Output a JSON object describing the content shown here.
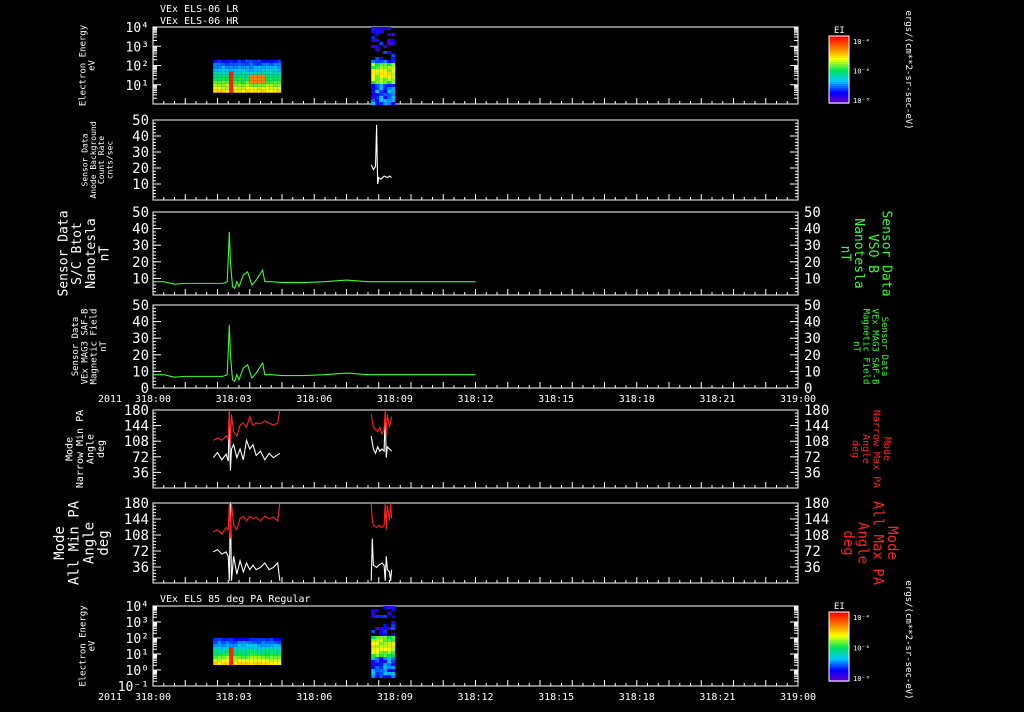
{
  "header": {
    "line1": "VEx ELS-06 LR",
    "line2": "VEx ELS-06 HR"
  },
  "panel7_title": "VEx ELS 85 deg PA Regular",
  "colorbar": {
    "label": "EI",
    "ticks": [
      "10⁻⁴",
      "10⁻⁶",
      "10⁻⁸"
    ],
    "side_label": "ergs/(cm**2-sr-sec-eV)"
  },
  "x_axis": {
    "year": "2011",
    "ticks": [
      "318:00",
      "318:03",
      "318:06",
      "318:09",
      "318:12",
      "318:15",
      "318:18",
      "318:21",
      "319:00"
    ]
  },
  "chart_data": [
    {
      "type": "heatmap",
      "id": "p1",
      "ylabel": [
        "Electron Energy",
        "eV"
      ],
      "ylim_exp": [
        0,
        4
      ],
      "yticks": [
        "10⁴",
        "10³",
        "10²",
        "10¹"
      ],
      "xlim_min": [
        0,
        60
      ],
      "segments": [
        {
          "x_range": [
            5.6,
            11.8
          ],
          "E_range_exp": [
            0.6,
            2.3
          ],
          "features": "red peak at 318:07 near 20 eV, red-orange streak 318:09-318:10"
        },
        {
          "x_range": [
            20.3,
            22.3
          ],
          "E_range_exp": [
            0.1,
            4.0
          ],
          "features": "green/yellow band 10-100 eV, purple noise above"
        }
      ]
    },
    {
      "type": "line",
      "id": "p2",
      "ylabel": [
        "Sensor Data",
        "Anode Background",
        "Count Rate",
        "cnts/sec"
      ],
      "ylim": [
        0,
        50
      ],
      "yticks": [
        10,
        20,
        30,
        40,
        50
      ],
      "series": [
        {
          "color": "#ffffff",
          "x_min": [
            20.3,
            20.5,
            20.7,
            20.8,
            20.85,
            20.9,
            21.0,
            21.2,
            21.5,
            21.8,
            22.0,
            22.2
          ],
          "y": [
            22,
            19,
            21,
            47,
            28,
            10,
            14,
            13,
            15,
            14,
            15,
            14
          ]
        }
      ]
    },
    {
      "type": "line",
      "id": "p3",
      "ylabel": [
        "Sensor Data",
        "S/C Btot",
        "Nanotesla",
        "nT"
      ],
      "right_label": [
        "Sensor Data",
        "VSO B",
        "Nanotesla",
        "nT"
      ],
      "ylim": [
        0,
        50
      ],
      "yticks": [
        10,
        20,
        30,
        40,
        50
      ],
      "series": [
        {
          "color": "#33ff33",
          "x_min": [
            0,
            1,
            2,
            3,
            4,
            5,
            6,
            6.5,
            6.9,
            7.0,
            7.1,
            7.2,
            7.4,
            7.6,
            7.8,
            8.0,
            8.4,
            8.8,
            9.0,
            9.2,
            9.6,
            10.0,
            10.2,
            10.4,
            11,
            12,
            14,
            16,
            18,
            20,
            22,
            24,
            26,
            28,
            30
          ],
          "y": [
            8,
            8,
            6.5,
            7,
            7,
            7,
            7,
            7,
            8,
            22,
            38,
            20,
            5,
            4,
            8,
            5,
            12,
            14,
            10,
            6,
            9,
            13,
            15,
            8,
            8,
            7.5,
            7.5,
            8,
            9,
            8,
            8,
            8,
            8,
            8,
            8
          ]
        }
      ]
    },
    {
      "type": "line",
      "id": "p4",
      "ylabel": [
        "Sensor Data",
        "VEx MAG3 SAF-B",
        "Magnetic Field",
        "nT"
      ],
      "right_label": [
        "Sensor Data",
        "VEx MAG3 SAF-B",
        "Magnetic Field",
        "nT"
      ],
      "ylim": [
        0,
        50
      ],
      "yticks": [
        0,
        10,
        20,
        30,
        40,
        50
      ],
      "series": [
        {
          "color": "#33ff33",
          "x_min": [
            0,
            1,
            2,
            3,
            4,
            5,
            6,
            6.5,
            6.9,
            7.0,
            7.1,
            7.2,
            7.4,
            7.6,
            7.8,
            8.0,
            8.4,
            8.8,
            9.0,
            9.2,
            9.6,
            10.0,
            10.2,
            10.4,
            11,
            12,
            14,
            16,
            18,
            20,
            22,
            24,
            26,
            28,
            30
          ],
          "y": [
            8,
            8,
            6.5,
            7,
            7,
            7,
            7,
            7,
            8,
            22,
            38,
            20,
            5,
            4,
            8,
            5,
            12,
            14,
            10,
            6,
            9,
            13,
            15,
            8,
            8,
            7.5,
            7.5,
            8,
            9,
            8,
            8,
            8,
            8,
            8,
            8
          ]
        }
      ]
    },
    {
      "type": "line",
      "id": "p5",
      "ylabel": [
        "Mode",
        "Narrow Min PA",
        "Angle",
        "deg"
      ],
      "right_label": [
        "Mode",
        "Narrow Max PA",
        "Angle",
        "deg"
      ],
      "ylim": [
        0,
        180
      ],
      "yticks": [
        36,
        72,
        108,
        144,
        180
      ],
      "series": [
        {
          "color": "#ffffff",
          "x_min": [
            5.6,
            6.0,
            6.4,
            6.8,
            7.0,
            7.1,
            7.2,
            7.3,
            7.5,
            7.8,
            8.1,
            8.4,
            8.7,
            9.0,
            9.3,
            9.6,
            10.0,
            10.4,
            10.8,
            11.2,
            11.8
          ],
          "y": [
            70,
            82,
            65,
            78,
            62,
            175,
            40,
            90,
            100,
            70,
            90,
            65,
            110,
            90,
            100,
            75,
            85,
            65,
            80,
            70,
            80
          ]
        },
        {
          "color": "#ff2222",
          "x_min": [
            5.6,
            6.0,
            6.4,
            6.8,
            7.0,
            7.1,
            7.2,
            7.3,
            7.5,
            7.8,
            8.1,
            8.4,
            8.7,
            9.0,
            9.3,
            9.6,
            10.0,
            10.4,
            10.8,
            11.2,
            11.6,
            11.8
          ],
          "y": [
            110,
            115,
            110,
            120,
            115,
            180,
            100,
            170,
            130,
            120,
            145,
            150,
            140,
            165,
            145,
            150,
            148,
            155,
            150,
            145,
            150,
            180
          ]
        },
        {
          "color": "#ffffff",
          "x_min": [
            20.3,
            20.5,
            20.7,
            20.9,
            21.1,
            21.3,
            21.5,
            21.6,
            21.7,
            21.8,
            22.0,
            22.2
          ],
          "y": [
            120,
            90,
            80,
            95,
            85,
            90,
            85,
            170,
            70,
            95,
            90,
            85
          ]
        },
        {
          "color": "#ff2222",
          "x_min": [
            20.3,
            20.5,
            20.7,
            20.9,
            21.1,
            21.3,
            21.5,
            21.6,
            21.7,
            21.8,
            22.0,
            22.2
          ],
          "y": [
            170,
            140,
            135,
            130,
            140,
            125,
            135,
            180,
            120,
            170,
            140,
            165
          ]
        }
      ]
    },
    {
      "type": "line",
      "id": "p6",
      "ylabel": [
        "Mode",
        "All Min PA",
        "Angle",
        "deg"
      ],
      "right_label": [
        "Mode",
        "All Max PA",
        "Angle",
        "deg"
      ],
      "ylim": [
        0,
        180
      ],
      "yticks": [
        36,
        72,
        108,
        144,
        180
      ],
      "series": [
        {
          "color": "#ffffff",
          "x_min": [
            5.6,
            6.0,
            6.4,
            6.8,
            7.0,
            7.1,
            7.2,
            7.3,
            7.5,
            7.8,
            8.1,
            8.4,
            8.7,
            9.0,
            9.3,
            9.6,
            10.0,
            10.4,
            10.8,
            11.2,
            11.6,
            11.8
          ],
          "y": [
            70,
            75,
            65,
            70,
            60,
            5,
            180,
            5,
            60,
            20,
            50,
            25,
            45,
            30,
            40,
            30,
            35,
            45,
            30,
            35,
            45,
            5
          ]
        },
        {
          "color": "#ff2222",
          "x_min": [
            5.6,
            6.0,
            6.4,
            6.8,
            7.0,
            7.1,
            7.2,
            7.3,
            7.5,
            7.8,
            8.1,
            8.4,
            8.7,
            9.0,
            9.3,
            9.6,
            10.0,
            10.4,
            10.8,
            11.2,
            11.6,
            11.8
          ],
          "y": [
            115,
            120,
            110,
            125,
            120,
            180,
            100,
            180,
            130,
            120,
            145,
            150,
            140,
            150,
            145,
            148,
            140,
            150,
            145,
            148,
            140,
            180
          ]
        },
        {
          "color": "#ffffff",
          "x_min": [
            20.3,
            20.4,
            20.5,
            20.8,
            21.0,
            21.3,
            21.5,
            21.6,
            21.7,
            21.8,
            22.0,
            22.1,
            22.2
          ],
          "y": [
            5,
            100,
            40,
            35,
            40,
            45,
            40,
            5,
            60,
            30,
            25,
            5,
            30
          ]
        },
        {
          "color": "#ff2222",
          "x_min": [
            20.3,
            20.4,
            20.5,
            20.8,
            21.0,
            21.3,
            21.5,
            21.6,
            21.7,
            21.8,
            22.0,
            22.1,
            22.2
          ],
          "y": [
            180,
            140,
            130,
            125,
            130,
            125,
            130,
            180,
            120,
            175,
            140,
            180,
            145
          ]
        }
      ]
    },
    {
      "type": "heatmap",
      "id": "p7",
      "ylabel": [
        "Electron Energy",
        "eV"
      ],
      "ylim_exp": [
        -1,
        4
      ],
      "yticks": [
        "10⁴",
        "10³",
        "10²",
        "10¹",
        "10⁰",
        "10⁻¹"
      ],
      "xlim_min": [
        0,
        60
      ],
      "segments": [
        {
          "x_range": [
            5.6,
            11.8
          ],
          "E_range_exp": [
            0.4,
            2.0
          ],
          "features": "red peak at 318:07"
        },
        {
          "x_range": [
            20.3,
            22.3
          ],
          "E_range_exp": [
            -0.4,
            4.0
          ],
          "features": "green band near 10 eV, scattered purple/blue above"
        }
      ]
    }
  ]
}
